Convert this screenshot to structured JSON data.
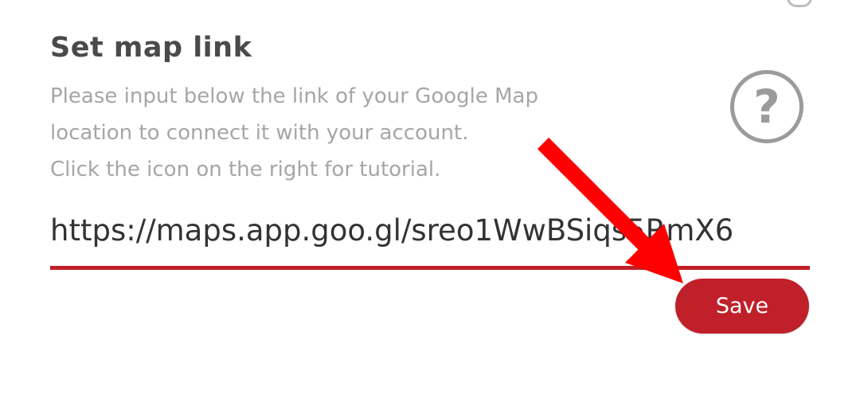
{
  "section": {
    "title": "Set map link",
    "description": [
      "Please input below the link of your Google Map",
      "location to connect it with your account.",
      "Click the icon on the right for tutorial."
    ],
    "help_icon_glyph": "?"
  },
  "link_input": {
    "value": "https://maps.app.goo.gl/sreo1WwBSiqs5RmX6"
  },
  "save_button": {
    "label": "Save"
  },
  "colors": {
    "accent": "#c0202a",
    "annotation_arrow": "#ff0000"
  }
}
